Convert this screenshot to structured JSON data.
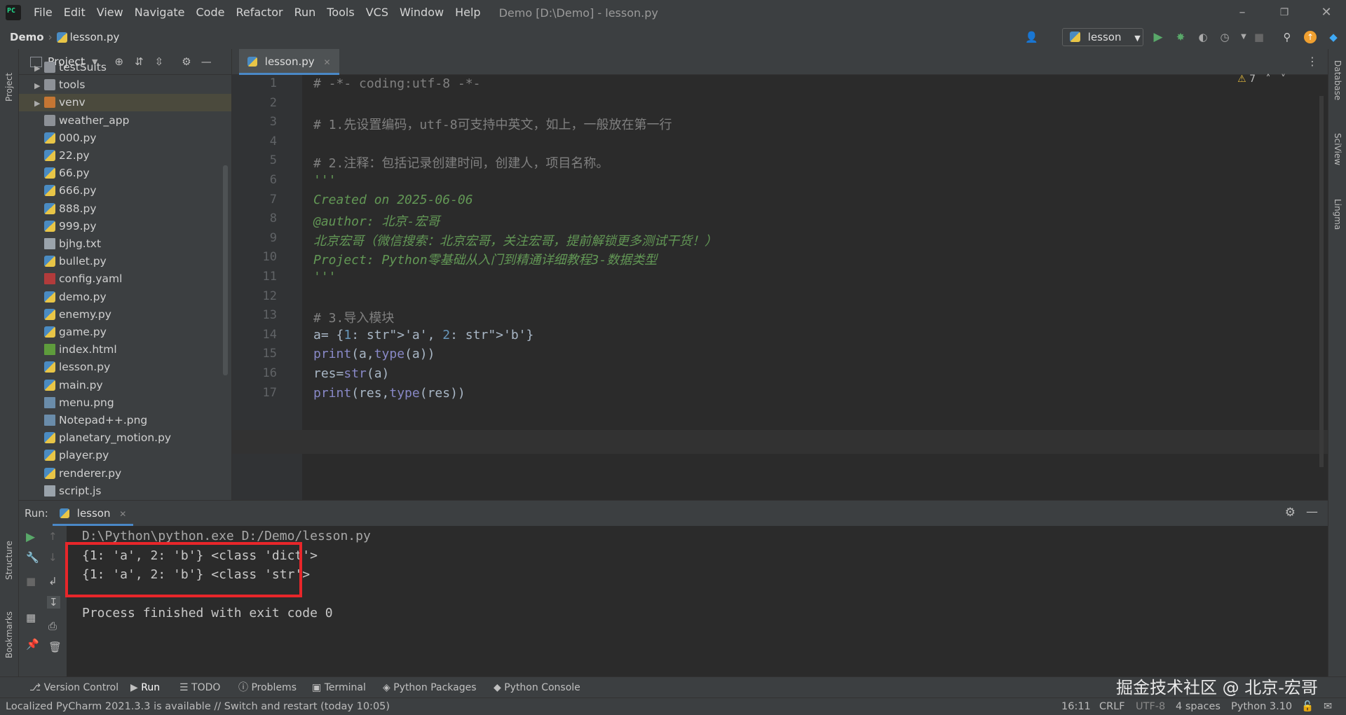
{
  "menu": [
    "File",
    "Edit",
    "View",
    "Navigate",
    "Code",
    "Refactor",
    "Run",
    "Tools",
    "VCS",
    "Window",
    "Help"
  ],
  "window_title": "Demo [D:\\Demo] - lesson.py",
  "breadcrumb": {
    "project": "Demo",
    "file": "lesson.py"
  },
  "run_config": "lesson",
  "left_strip": {
    "project": "Project",
    "structure": "Structure",
    "bookmarks": "Bookmarks"
  },
  "right_strip": {
    "database": "Database",
    "sciview": "SciView",
    "lingma": "Lingma"
  },
  "project_panel": {
    "title": "Project",
    "items": [
      {
        "name": "testSuits",
        "kind": "folder",
        "expandable": true
      },
      {
        "name": "tools",
        "kind": "folder",
        "expandable": true
      },
      {
        "name": "venv",
        "kind": "folder-orange",
        "expandable": true
      },
      {
        "name": "weather_app",
        "kind": "folder",
        "expandable": false
      },
      {
        "name": "000.py",
        "kind": "py"
      },
      {
        "name": "22.py",
        "kind": "py"
      },
      {
        "name": "66.py",
        "kind": "py"
      },
      {
        "name": "666.py",
        "kind": "py"
      },
      {
        "name": "888.py",
        "kind": "py"
      },
      {
        "name": "999.py",
        "kind": "py"
      },
      {
        "name": "bjhg.txt",
        "kind": "txt"
      },
      {
        "name": "bullet.py",
        "kind": "py"
      },
      {
        "name": "config.yaml",
        "kind": "yaml"
      },
      {
        "name": "demo.py",
        "kind": "py"
      },
      {
        "name": "enemy.py",
        "kind": "py"
      },
      {
        "name": "game.py",
        "kind": "py"
      },
      {
        "name": "index.html",
        "kind": "html"
      },
      {
        "name": "lesson.py",
        "kind": "py"
      },
      {
        "name": "main.py",
        "kind": "py"
      },
      {
        "name": "menu.png",
        "kind": "png"
      },
      {
        "name": "Notepad++.png",
        "kind": "png"
      },
      {
        "name": "planetary_motion.py",
        "kind": "py"
      },
      {
        "name": "player.py",
        "kind": "py"
      },
      {
        "name": "renderer.py",
        "kind": "py"
      },
      {
        "name": "script.js",
        "kind": "txt"
      }
    ]
  },
  "editor": {
    "tab": "lesson.py",
    "warnings": "7",
    "lines": [
      {
        "n": "1",
        "text": "# -*- coding:utf-8 -*-",
        "style": "cmt"
      },
      {
        "n": "2",
        "text": "",
        "style": "cmt"
      },
      {
        "n": "3",
        "text": "# 1.先设置编码，utf-8可支持中英文，如上，一般放在第一行",
        "style": "cmt"
      },
      {
        "n": "4",
        "text": "",
        "style": "cmt"
      },
      {
        "n": "5",
        "text": "# 2.注释：包括记录创建时间，创建人，项目名称。",
        "style": "cmt"
      },
      {
        "n": "6",
        "text": "'''",
        "style": "doc"
      },
      {
        "n": "7",
        "text": "Created on 2025-06-06",
        "style": "doc"
      },
      {
        "n": "8",
        "text": "@author: 北京-宏哥",
        "style": "doc"
      },
      {
        "n": "9",
        "text": "北京宏哥（微信搜索：北京宏哥，关注宏哥，提前解锁更多测试干货！）",
        "style": "doc"
      },
      {
        "n": "10",
        "text": "Project: Python零基础从入门到精通详细教程3-数据类型",
        "style": "doc"
      },
      {
        "n": "11",
        "text": "'''",
        "style": "doc"
      },
      {
        "n": "12",
        "text": "",
        "style": "cmt"
      },
      {
        "n": "13",
        "text": "# 3.导入模块",
        "style": "cmt"
      },
      {
        "n": "14",
        "text": "a= {1: 'a', 2: 'b'}",
        "style": "code"
      },
      {
        "n": "15",
        "text": "print(a,type(a))",
        "style": "code"
      },
      {
        "n": "16",
        "text": "res=str(a)",
        "style": "code"
      },
      {
        "n": "17",
        "text": "print(res,type(res))",
        "style": "code"
      }
    ]
  },
  "run_panel": {
    "label": "Run:",
    "tab": "lesson",
    "output": [
      "D:\\Python\\python.exe D:/Demo/lesson.py",
      "{1: 'a', 2: 'b'} <class 'dict'>",
      "{1: 'a', 2: 'b'} <class 'str'>",
      "",
      "Process finished with exit code 0"
    ]
  },
  "bottom_tools": [
    "Version Control",
    "Run",
    "TODO",
    "Problems",
    "Terminal",
    "Python Packages",
    "Python Console"
  ],
  "status": {
    "message": "Localized PyCharm 2021.3.3 is available // Switch and restart (today 10:05)",
    "position": "16:11",
    "line_sep": "CRLF",
    "encoding": "UTF-8",
    "indent": "4 spaces",
    "interpreter": "Python 3.10"
  },
  "watermark": "掘金技术社区 @ 北京-宏哥",
  "colors": {
    "accent": "#4a88c7",
    "highlight_box": "#e8262a",
    "run_green": "#59a869"
  }
}
